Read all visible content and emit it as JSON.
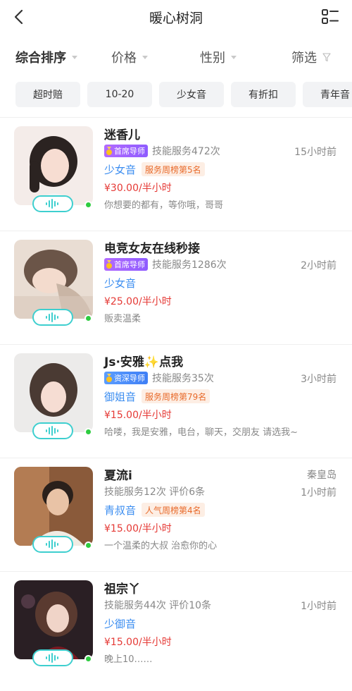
{
  "header": {
    "title": "暖心树洞",
    "back_icon": "chevron-left-icon",
    "menu_icon": "list-view-icon"
  },
  "sort": {
    "items": [
      {
        "label": "综合排序",
        "active": true
      },
      {
        "label": "价格",
        "active": false
      },
      {
        "label": "性别",
        "active": false
      },
      {
        "label": "筛选",
        "active": false
      }
    ]
  },
  "tags": [
    "超时赔",
    "10-20",
    "少女音",
    "有折扣",
    "青年音"
  ],
  "colors": {
    "accent_teal": "#3ecfcf",
    "price_red": "#e53935",
    "voice_blue": "#3b8df0",
    "rank_orange": "#e86a2a",
    "online_green": "#2ecc40"
  },
  "listings": [
    {
      "name": "迷香儿",
      "badge": "首席导师",
      "badge_type": "chief",
      "stats": "技能服务472次",
      "time": "15小时前",
      "location": "",
      "voice_type": "少女音",
      "rank": "服务周榜第5名",
      "price": "¥30.00/半小时",
      "intro": "你想要的都有，等你哦，哥哥"
    },
    {
      "name": "电竞女友在线秒接",
      "badge": "首席导师",
      "badge_type": "chief",
      "stats": "技能服务1286次",
      "time": "2小时前",
      "location": "",
      "voice_type": "少女音",
      "rank": "",
      "price": "¥25.00/半小时",
      "intro": "贩卖温柔"
    },
    {
      "name": "Js·安雅✨点我",
      "badge": "资深导师",
      "badge_type": "senior",
      "stats": "技能服务35次",
      "time": "3小时前",
      "location": "",
      "voice_type": "御姐音",
      "rank": "服务周榜第79名",
      "price": "¥15.00/半小时",
      "intro": "哈喽，我是安雅，电台，聊天，交朋友 请选我~"
    },
    {
      "name": "夏流i",
      "badge": "",
      "badge_type": "",
      "stats": "技能服务12次  评价6条",
      "time": "1小时前",
      "location": "秦皇岛",
      "voice_type": "青叔音",
      "rank": "人气周榜第4名",
      "price": "¥15.00/半小时",
      "intro": "一个温柔的大叔 治愈你的心"
    },
    {
      "name": "祖宗丫",
      "badge": "",
      "badge_type": "",
      "stats": "技能服务44次  评价10条",
      "time": "1小时前",
      "location": "",
      "voice_type": "少御音",
      "rank": "",
      "price": "¥15.00/半小时",
      "intro": "晚上10……"
    }
  ]
}
